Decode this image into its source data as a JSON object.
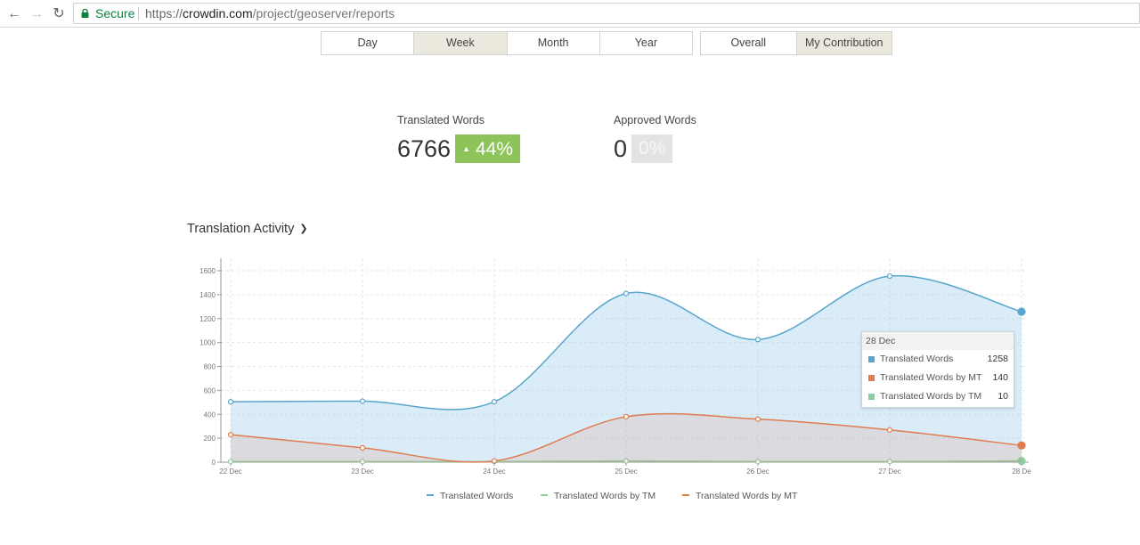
{
  "browser": {
    "secure_label": "Secure",
    "url_scheme": "https://",
    "url_host": "crowdin.com",
    "url_path": "/project/geoserver/reports"
  },
  "period_tabs": [
    {
      "label": "Day",
      "active": false
    },
    {
      "label": "Week",
      "active": true
    },
    {
      "label": "Month",
      "active": false
    },
    {
      "label": "Year",
      "active": false
    }
  ],
  "scope_tabs": [
    {
      "label": "Overall",
      "active": false
    },
    {
      "label": "My Contribution",
      "active": true
    }
  ],
  "stats": {
    "translated": {
      "label": "Translated Words",
      "value": "6766",
      "change": "44%"
    },
    "approved": {
      "label": "Approved Words",
      "value": "0",
      "change": "0%"
    }
  },
  "chart_header": {
    "title": "Translation Activity"
  },
  "colors": {
    "translated": "#5aa5cc",
    "mt": "#e07c4f",
    "tm": "#8fcba0",
    "badge_up": "#8dc45a"
  },
  "chart_data": {
    "type": "area",
    "title": "Translation Activity",
    "categories": [
      "22 Dec",
      "23 Dec",
      "24 Dec",
      "25 Dec",
      "26 Dec",
      "27 Dec",
      "28 Dec"
    ],
    "category_labels": [
      "22 Dec",
      "23 Dec",
      "24 Dec",
      "25 Dec",
      "26 Dec",
      "27 Dec",
      "28 De"
    ],
    "ylim": [
      0,
      1600
    ],
    "yticks": [
      0,
      200,
      400,
      600,
      800,
      1000,
      1200,
      1400,
      1600
    ],
    "grid": true,
    "legend_position": "bottom",
    "series": [
      {
        "name": "Translated Words",
        "values": [
          505,
          510,
          505,
          1410,
          1025,
          1555,
          1258
        ]
      },
      {
        "name": "Translated Words by TM",
        "values": [
          5,
          5,
          5,
          10,
          5,
          5,
          10
        ]
      },
      {
        "name": "Translated Words by MT",
        "values": [
          230,
          120,
          10,
          380,
          360,
          270,
          140
        ]
      }
    ],
    "tooltip": {
      "title": "28 Dec",
      "rows": [
        {
          "name": "Translated Words",
          "value": "1258"
        },
        {
          "name": "Translated Words by MT",
          "value": "140"
        },
        {
          "name": "Translated Words by TM",
          "value": "10"
        }
      ]
    }
  }
}
